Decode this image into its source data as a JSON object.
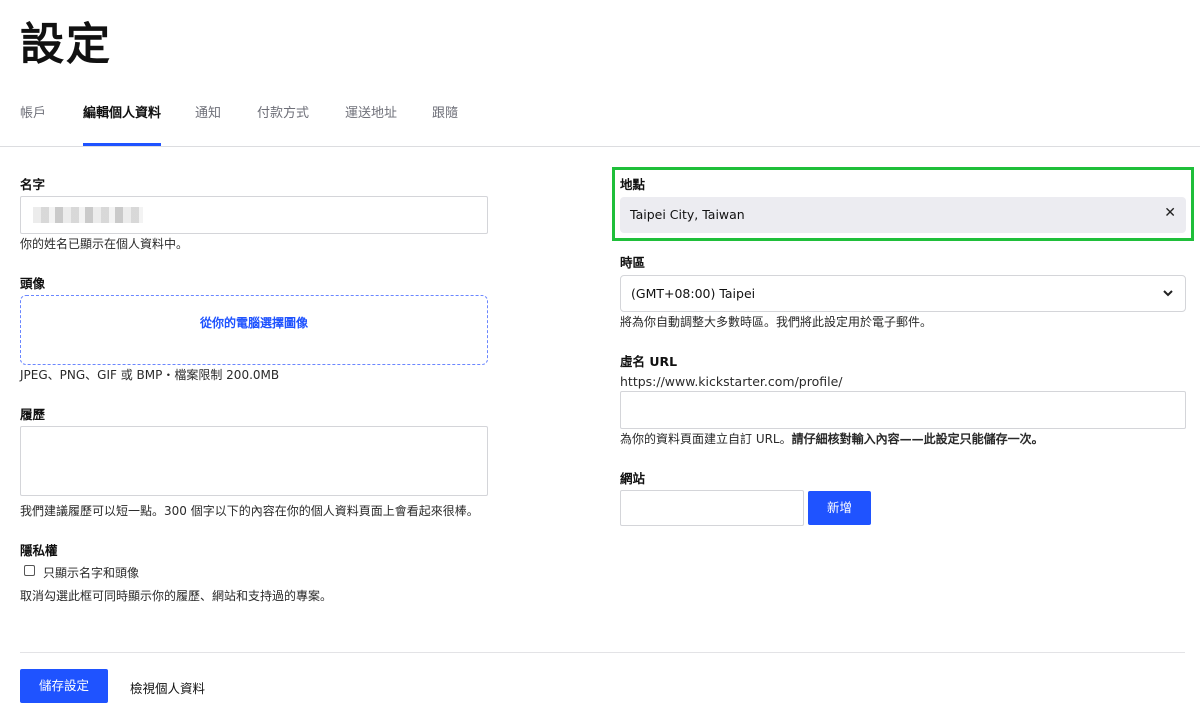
{
  "page": {
    "title": "設定"
  },
  "tabs": [
    {
      "label": "帳戶"
    },
    {
      "label": "編輯個人資料"
    },
    {
      "label": "通知"
    },
    {
      "label": "付款方式"
    },
    {
      "label": "運送地址"
    },
    {
      "label": "跟隨"
    }
  ],
  "active_tab": "編輯個人資料",
  "left": {
    "name": {
      "label": "名字",
      "help": "你的姓名已顯示在個人資料中。"
    },
    "avatar": {
      "label": "頭像",
      "upload_text": "從你的電腦選擇圖像",
      "help": "JPEG、PNG、GIF 或 BMP・檔案限制 200.0MB"
    },
    "bio": {
      "label": "履歷",
      "help": "我們建議履歷可以短一點。300 個字以下的內容在你的個人資料頁面上會看起來很棒。"
    },
    "privacy": {
      "label": "隱私權",
      "checkbox_label": "只顯示名字和頭像",
      "checked": false,
      "help": "取消勾選此框可同時顯示你的履歷、網站和支持過的專案。"
    }
  },
  "right": {
    "location": {
      "label": "地點",
      "value": "Taipei City, Taiwan",
      "clear_icon": "close-icon"
    },
    "timezone": {
      "label": "時區",
      "value": "(GMT+08:00) Taipei",
      "help": "將為你自動調整大多數時區。我們將此設定用於電子郵件。"
    },
    "vanity_url": {
      "label": "虛名 URL",
      "prefix": "https://www.kickstarter.com/profile/",
      "help_prefix": "為你的資料頁面建立自訂 URL。",
      "help_bold": "請仔細核對輸入內容——此設定只能儲存一次。"
    },
    "website": {
      "label": "網站",
      "add_label": "新增"
    }
  },
  "footer": {
    "save_label": "儲存設定",
    "view_label": "檢視個人資料"
  },
  "colors": {
    "accent": "#1f53ff",
    "highlight": "#1fbf3a"
  }
}
